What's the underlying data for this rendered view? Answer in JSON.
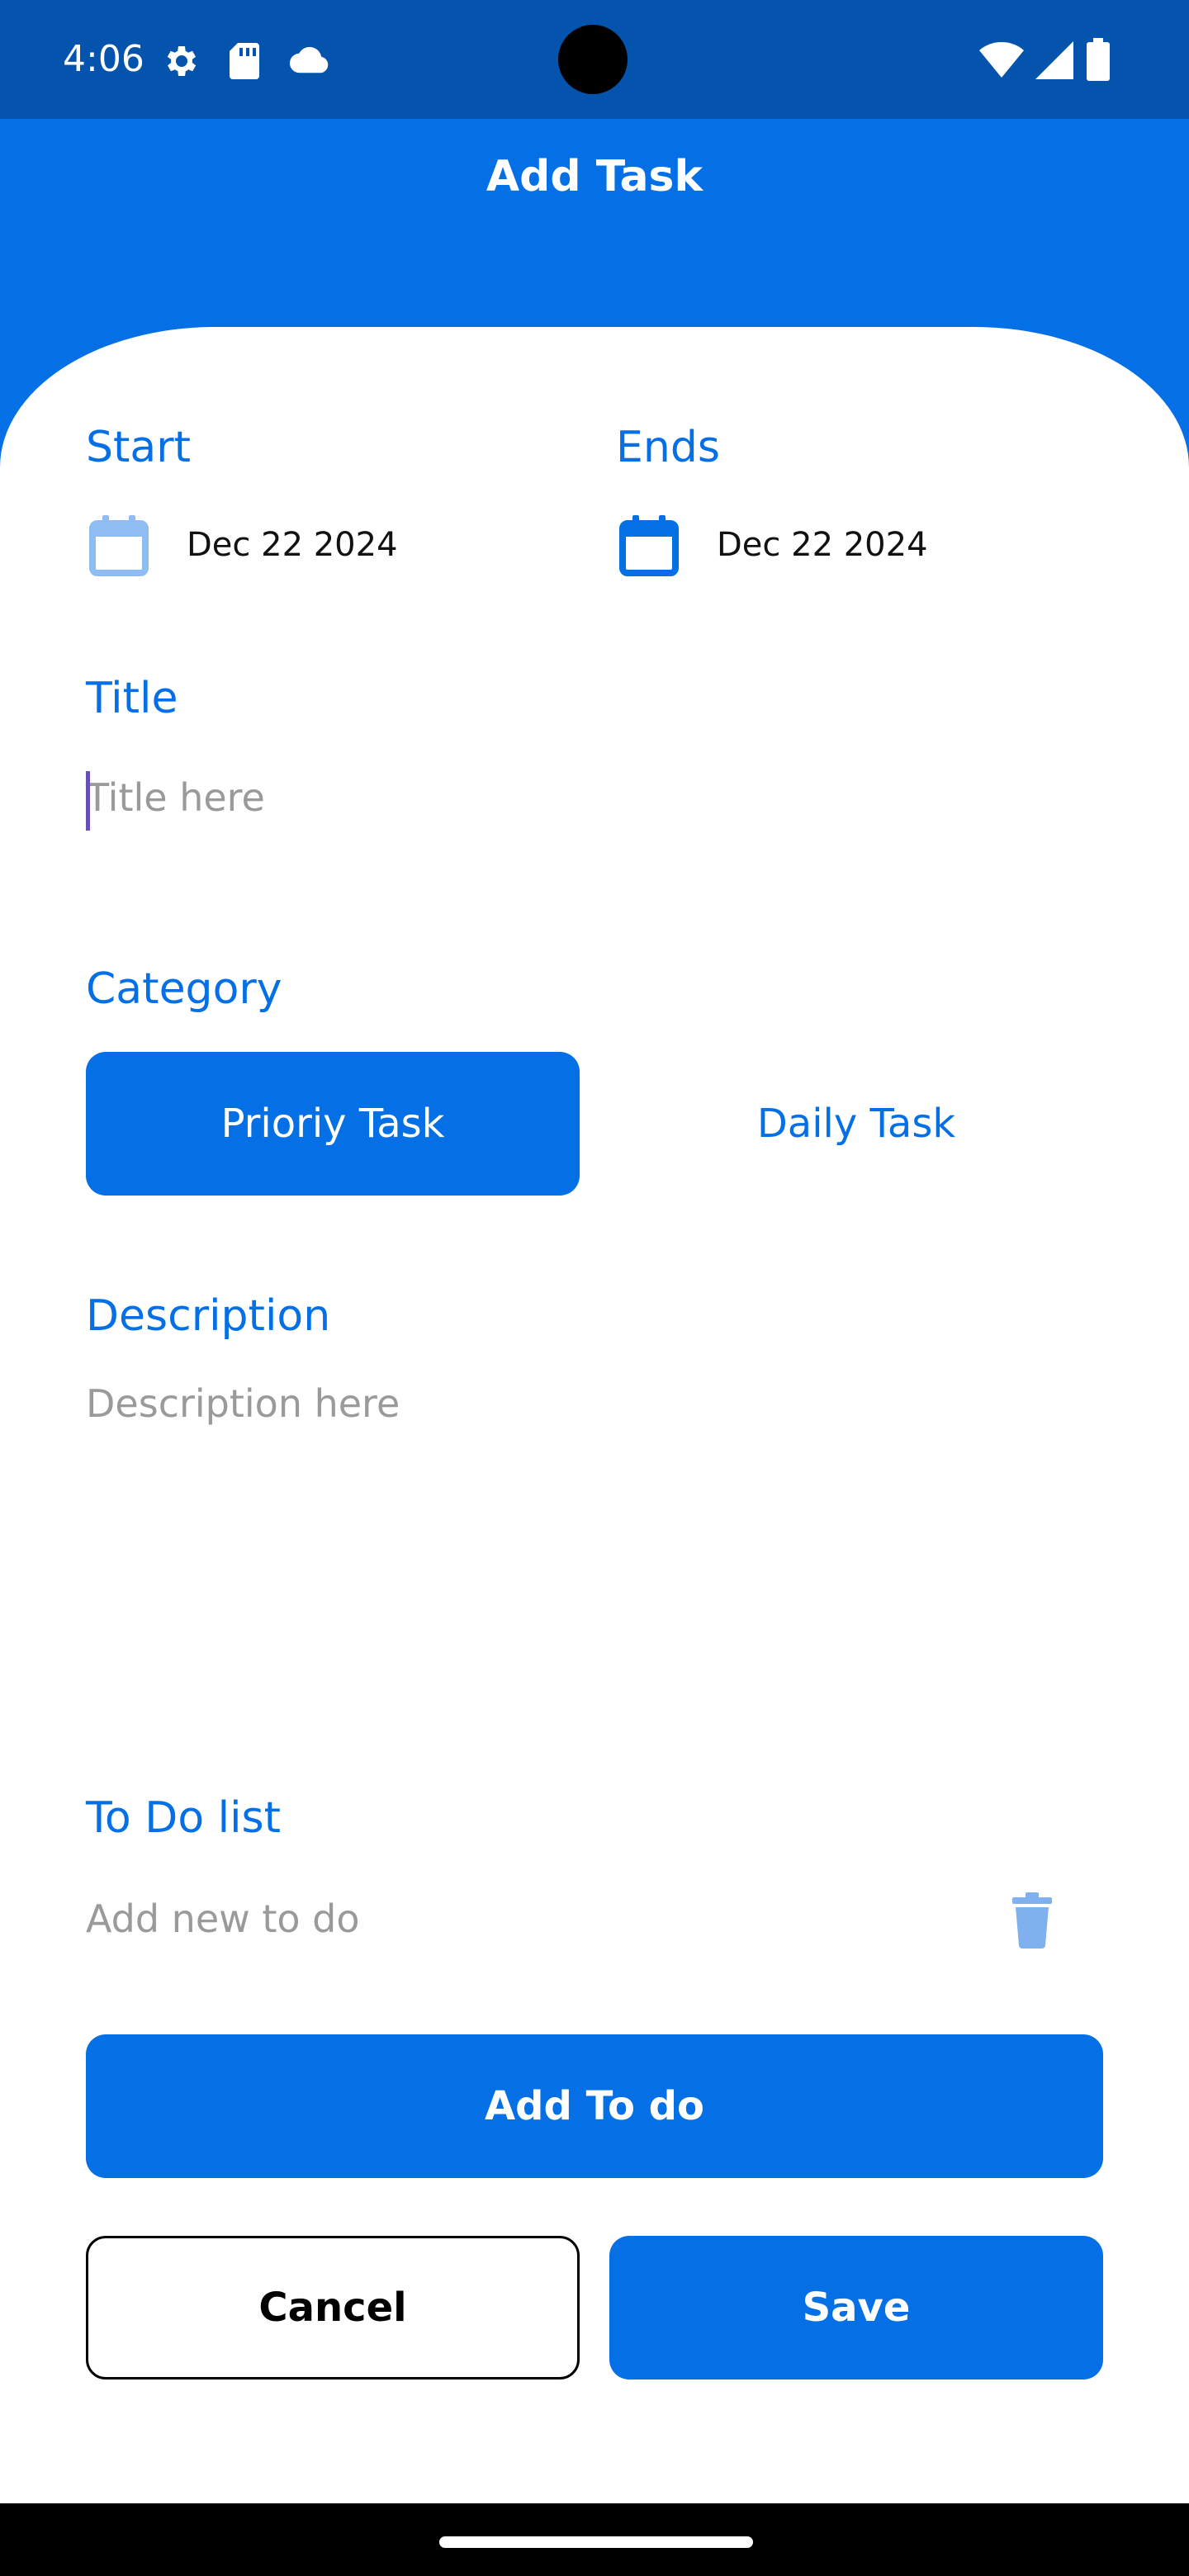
{
  "status_bar": {
    "time": "4:06",
    "icons": [
      "settings-icon",
      "sd-card-icon",
      "cloud-icon",
      "wifi-icon",
      "signal-icon",
      "battery-icon"
    ]
  },
  "header": {
    "title": "Add Task"
  },
  "dates": {
    "start_label": "Start",
    "start_value": "Dec 22 2024",
    "end_label": "Ends",
    "end_value": "Dec 22 2024"
  },
  "title_field": {
    "label": "Title",
    "placeholder": "Title here",
    "value": ""
  },
  "category": {
    "label": "Category",
    "options": [
      "Prioriy Task",
      "Daily Task"
    ],
    "selected": "Prioriy Task"
  },
  "description": {
    "label": "Description",
    "placeholder": "Description here"
  },
  "todo": {
    "label": "To Do list",
    "placeholder": "Add new to do",
    "add_button": "Add To do"
  },
  "actions": {
    "cancel": "Cancel",
    "save": "Save"
  },
  "colors": {
    "accent": "#0570e6",
    "status_bar": "#0454ad",
    "placeholder": "#9a9a9a"
  }
}
